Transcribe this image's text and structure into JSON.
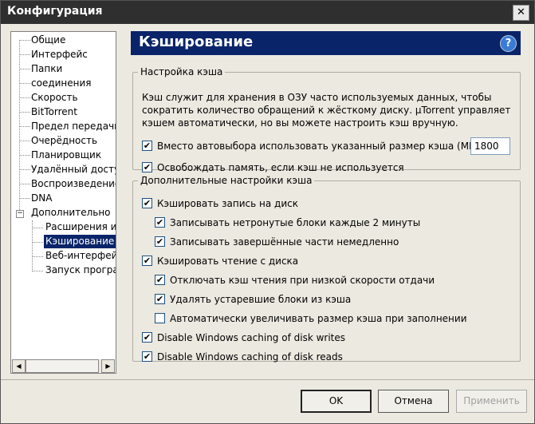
{
  "window": {
    "title": "Конфигурация",
    "close_glyph": "✕"
  },
  "tree": {
    "items": [
      {
        "label": "Общие"
      },
      {
        "label": "Интерфейс"
      },
      {
        "label": "Папки"
      },
      {
        "label": "соединения"
      },
      {
        "label": "Скорость"
      },
      {
        "label": "BitTorrent"
      },
      {
        "label": "Предел передачи"
      },
      {
        "label": "Очерёдность"
      },
      {
        "label": "Планировщик"
      },
      {
        "label": "Удалённый доступ"
      },
      {
        "label": "Воспроизведение"
      },
      {
        "label": "DNA"
      },
      {
        "label": "Дополнительно"
      },
      {
        "label": "Расширения интерфейса"
      },
      {
        "label": "Кэширование"
      },
      {
        "label": "Веб-интерфейс"
      },
      {
        "label": "Запуск программ"
      }
    ],
    "expander_glyph": "−",
    "scroll_left": "◀",
    "scroll_right": "▶"
  },
  "panel": {
    "title": "Кэширование",
    "help_glyph": "?"
  },
  "cache_settings": {
    "legend": "Настройка кэша",
    "description": "Кэш служит для хранения в ОЗУ часто используемых данных, чтобы сократить количество обращений к жёсткому диску. µTorrent управляет кэшем автоматически, но вы можете настроить кэш вручную.",
    "override_label": "Вместо автовыбора использовать указанный размер кэша (МБ):",
    "override_checked": true,
    "size_value": "1800",
    "free_label": "Освобождать память, если кэш не используется",
    "free_checked": true
  },
  "advanced": {
    "legend": "Дополнительные настройки кэша",
    "items": [
      {
        "label": "Кэшировать запись на диск",
        "checked": true
      },
      {
        "label": "Записывать нетронутые блоки каждые 2 минуты",
        "checked": true
      },
      {
        "label": "Записывать завершённые части немедленно",
        "checked": true
      },
      {
        "label": "Кэшировать чтение с диска",
        "checked": true
      },
      {
        "label": "Отключать кэш чтения при низкой скорости отдачи",
        "checked": true
      },
      {
        "label": "Удалять устаревшие блоки из кэша",
        "checked": true
      },
      {
        "label": "Автоматически увеличивать размер кэша при заполнении",
        "checked": false
      },
      {
        "label": "Disable Windows caching of disk writes",
        "checked": true
      },
      {
        "label": "Disable Windows caching of disk reads",
        "checked": true
      }
    ]
  },
  "footer": {
    "ok": "OK",
    "cancel": "Отмена",
    "apply": "Применить"
  },
  "check_glyph": "✔"
}
